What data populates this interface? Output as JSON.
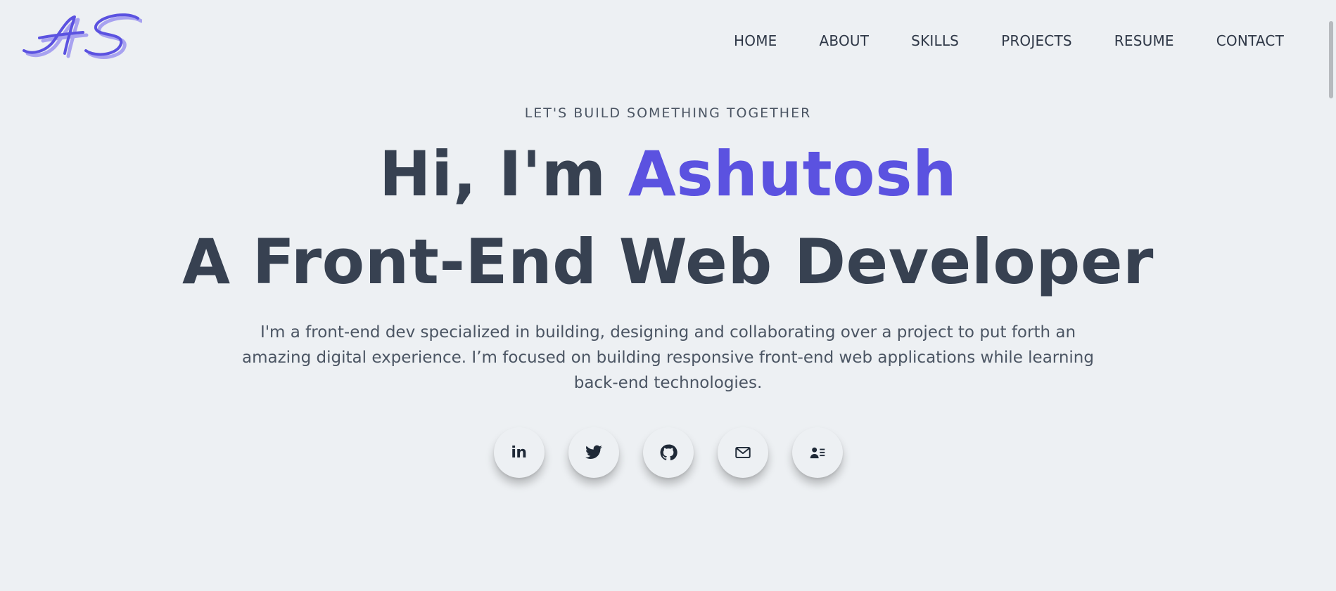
{
  "logo": {
    "text": "AS",
    "icon": "signature-logo"
  },
  "nav": {
    "items": [
      {
        "label": "HOME"
      },
      {
        "label": "ABOUT"
      },
      {
        "label": "SKILLS"
      },
      {
        "label": "PROJECTS"
      },
      {
        "label": "RESUME"
      },
      {
        "label": "CONTACT"
      }
    ]
  },
  "hero": {
    "tagline": "LET'S BUILD SOMETHING TOGETHER",
    "greeting": "Hi, I'm ",
    "name": "Ashutosh",
    "title": "A Front-End Web Developer",
    "description": "I'm a front-end dev specialized in building, designing and collaborating over a project to put forth an amazing digital experience. I’m focused on building responsive front-end web applications while learning back-end technologies."
  },
  "social": {
    "linkedin_text": "in",
    "icons": [
      "linkedin-icon",
      "twitter-icon",
      "github-icon",
      "mail-icon",
      "contact-card-icon"
    ]
  },
  "colors": {
    "accent": "#5b52e0",
    "text": "#374151",
    "background": "#edf0f3"
  }
}
